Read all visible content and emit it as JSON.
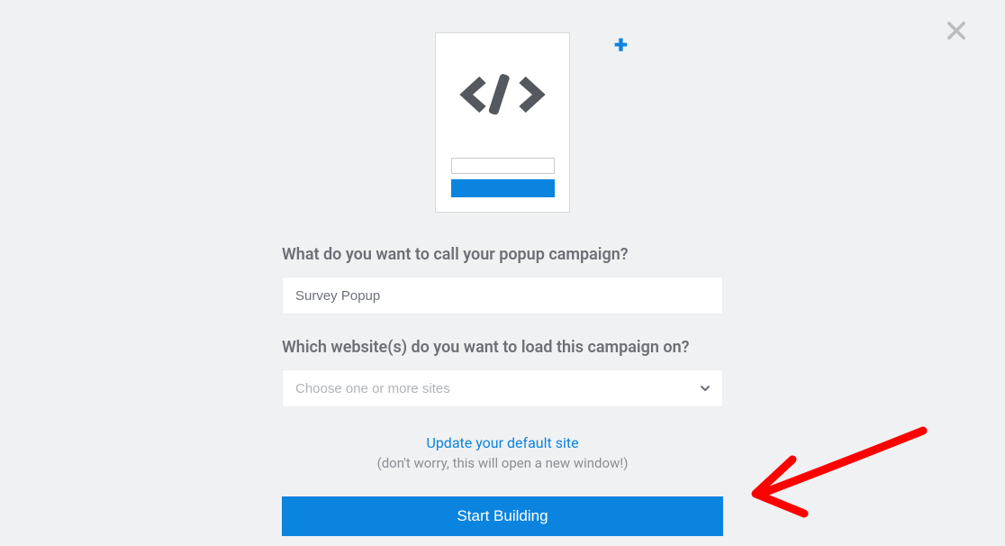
{
  "form": {
    "name_label": "What do you want to call your popup campaign?",
    "name_value": "Survey Popup",
    "site_label": "Which website(s) do you want to load this campaign on?",
    "site_placeholder": "Choose one or more sites",
    "default_site_link": "Update your default site",
    "default_site_hint": "(don't worry, this will open a new window!)",
    "submit_label": "Start Building"
  },
  "colors": {
    "primary": "#0b84e0",
    "text_muted": "#6b7078",
    "annotation": "#ff0000"
  }
}
